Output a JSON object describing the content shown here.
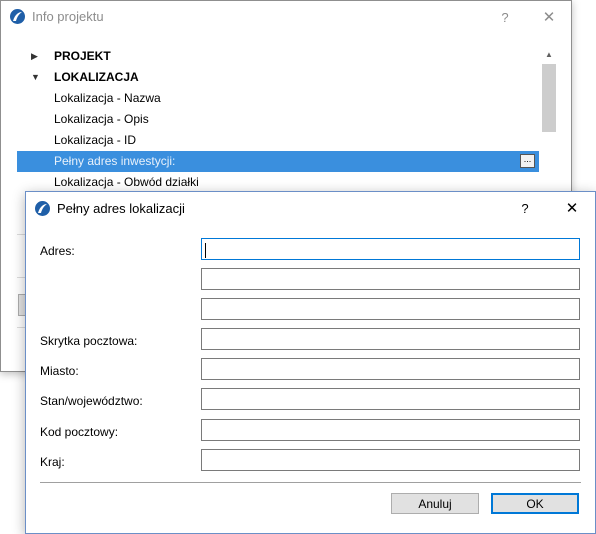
{
  "back_window": {
    "title": "Info projektu",
    "help_glyph": "?",
    "close_glyph": "✕",
    "tree": [
      {
        "label": "PROJEKT",
        "kind": "group",
        "expanded": false,
        "arrow": "▶"
      },
      {
        "label": "LOKALIZACJA",
        "kind": "group",
        "expanded": true,
        "arrow": "▼"
      },
      {
        "label": "Lokalizacja - Nazwa",
        "kind": "item"
      },
      {
        "label": "Lokalizacja - Opis",
        "kind": "item"
      },
      {
        "label": "Lokalizacja - ID",
        "kind": "item"
      },
      {
        "label": "Pełny adres inwestycji:",
        "kind": "item",
        "selected": true,
        "button": "..."
      },
      {
        "label": "Lokalizacja - Obwód działki",
        "kind": "item"
      }
    ],
    "scroll_up_glyph": "▲"
  },
  "dialog": {
    "title": "Pełny adres lokalizacji",
    "help_glyph": "?",
    "close_glyph": "✕",
    "fields": {
      "address_label": "Adres:",
      "address_line1": "",
      "address_line2": "",
      "address_line3": "",
      "po_box_label": "Skrytka pocztowa:",
      "po_box": "",
      "city_label": "Miasto:",
      "city": "",
      "state_label": "Stan/województwo:",
      "state": "",
      "postal_label": "Kod pocztowy:",
      "postal": "",
      "country_label": "Kraj:",
      "country": ""
    },
    "cancel_label": "Anuluj",
    "ok_label": "OK",
    "accent": "#0078d7"
  },
  "icons": {
    "app": "archicad-logo-icon",
    "help": "help-icon",
    "close": "close-icon"
  }
}
